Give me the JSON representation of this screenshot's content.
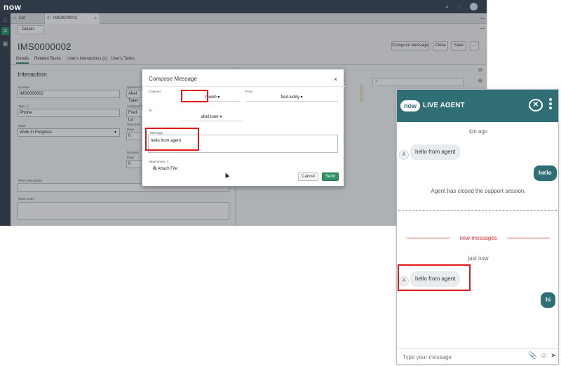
{
  "app": {
    "logo": "now",
    "tabs": [
      {
        "label": "List"
      },
      {
        "label": "IMS0000002",
        "close": "×"
      }
    ],
    "tabbar_right": "—",
    "subtab": "Details",
    "formhdr_min": "—",
    "record_title": "IMS0000002",
    "header_buttons": {
      "compose": "Compose Message",
      "close": "Close",
      "save": "Save",
      "more": "···"
    },
    "form_tabs": [
      "Details",
      "Related Tasks",
      "User's Interactions (1)",
      "User's Tasks"
    ],
    "section_title": "Interaction",
    "fields": {
      "number_label": "Number",
      "number_value": "IMS0000002",
      "type_label": "Type ⓘ",
      "type_value": "Phone",
      "state_label": "State",
      "state_value": "Work in Progress",
      "opened_for_label": "Opened for",
      "opened_for_value": "Abel Tuter",
      "assigned_to_label": "Assigned to",
      "assigned_to_value": "Fred Lu",
      "wait_time_label": "Wait time",
      "wait_days_label": "Days",
      "wait_days_value": "0",
      "duration_label": "Duration",
      "duration_days_label": "Days",
      "duration_days_value": "0",
      "short_desc_label": "Short description",
      "work_notes_label": "Work notes"
    },
    "rightpane": {
      "search_icon": "⌕",
      "right_icons": [
        "👁",
        "🖇"
      ],
      "faded_btn": "Post"
    }
  },
  "dialog": {
    "title": "Compose Message",
    "close": "×",
    "channel_label": "Channel",
    "channel_value": "mweb ▾",
    "from_label": "From",
    "from_value": "fred.luddy ▾",
    "to_label": "To",
    "to_value": "abel.tuter ▾",
    "message_label": "Message",
    "message_value": "hello from agent",
    "attachment_label": "Attachment ⓘ",
    "attach_link": "Attach File",
    "cancel": "Cancel",
    "send": "Send"
  },
  "chat": {
    "badge": "now",
    "title": "LIVE AGENT",
    "end_icon": "✕",
    "timestamp1": "4m ago",
    "agent_initial": "A",
    "msg_in1": "hello from agent",
    "msg_out1": "hello",
    "system_msg": "Agent has closed the support session.",
    "new_messages": "new messages",
    "timestamp2": "just now",
    "msg_in2": "hello from agent",
    "msg_out2": "hi",
    "input_placeholder": "Type your message",
    "icons": {
      "attach": "📎",
      "emoji": "☺",
      "send": "➤"
    }
  }
}
